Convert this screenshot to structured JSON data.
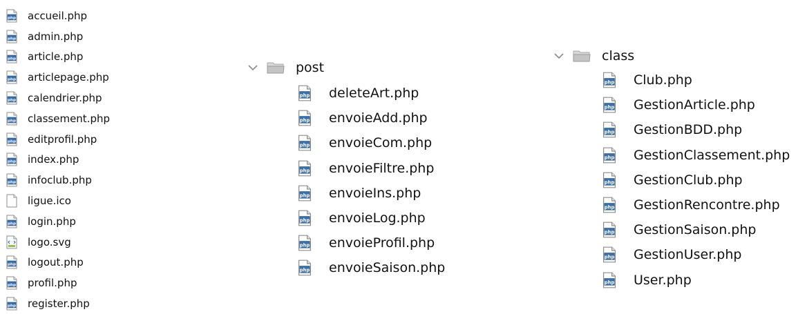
{
  "left_files": [
    {
      "name": "accueil.php",
      "icon": "php-file-icon"
    },
    {
      "name": "admin.php",
      "icon": "php-file-icon"
    },
    {
      "name": "article.php",
      "icon": "php-file-icon"
    },
    {
      "name": "articlepage.php",
      "icon": "php-file-icon"
    },
    {
      "name": "calendrier.php",
      "icon": "php-file-icon"
    },
    {
      "name": "classement.php",
      "icon": "php-file-icon"
    },
    {
      "name": "editprofil.php",
      "icon": "php-file-icon"
    },
    {
      "name": "index.php",
      "icon": "php-file-icon"
    },
    {
      "name": "infoclub.php",
      "icon": "php-file-icon"
    },
    {
      "name": "ligue.ico",
      "icon": "blank-file-icon"
    },
    {
      "name": "login.php",
      "icon": "php-file-icon"
    },
    {
      "name": "logo.svg",
      "icon": "svg-file-icon"
    },
    {
      "name": "logout.php",
      "icon": "php-file-icon"
    },
    {
      "name": "profil.php",
      "icon": "php-file-icon"
    },
    {
      "name": "register.php",
      "icon": "php-file-icon"
    }
  ],
  "post_folder": {
    "name": "post",
    "files": [
      "deleteArt.php",
      "envoieAdd.php",
      "envoieCom.php",
      "envoieFiltre.php",
      "envoieIns.php",
      "envoieLog.php",
      "envoieProfil.php",
      "envoieSaison.php"
    ]
  },
  "class_folder": {
    "name": "class",
    "files": [
      "Club.php",
      "GestionArticle.php",
      "GestionBDD.php",
      "GestionClassement.php",
      "GestionClub.php",
      "GestionRencontre.php",
      "GestionSaison.php",
      "GestionUser.php",
      "User.php"
    ]
  },
  "icon_badge_text": "php",
  "colors": {
    "php_badge": "#3b6fa8",
    "php_badge_dark": "#1f4f84",
    "folder": "#cfcfcf",
    "chevron": "#8a8a8a"
  }
}
